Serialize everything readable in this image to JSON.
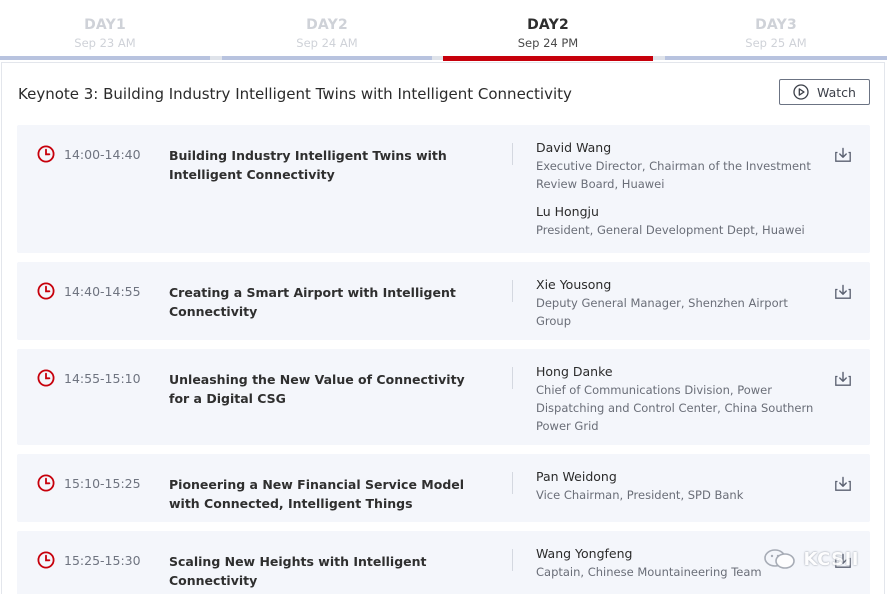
{
  "tabs": [
    {
      "day": "DAY1",
      "date": "Sep 23 AM",
      "active": false
    },
    {
      "day": "DAY2",
      "date": "Sep 24 AM",
      "active": false
    },
    {
      "day": "DAY2",
      "date": "Sep 24 PM",
      "active": true
    },
    {
      "day": "DAY3",
      "date": "Sep 25 AM",
      "active": false
    }
  ],
  "keynote": {
    "title": "Keynote 3: Building Industry Intelligent Twins with Intelligent Connectivity",
    "watch_label": "Watch"
  },
  "sessions": [
    {
      "time": "14:00-14:40",
      "title": "Building Industry Intelligent Twins with Intelligent Connectivity",
      "speakers": [
        {
          "name": "David Wang",
          "role": "Executive Director, Chairman of the Investment Review Board, Huawei"
        },
        {
          "name": "Lu Hongju",
          "role": "President, General Development Dept, Huawei"
        }
      ]
    },
    {
      "time": "14:40-14:55",
      "title": "Creating a Smart Airport with Intelligent Connectivity",
      "speakers": [
        {
          "name": "Xie Yousong",
          "role": "Deputy General Manager, Shenzhen Airport Group"
        }
      ]
    },
    {
      "time": "14:55-15:10",
      "title": "Unleashing the New Value of Connectivity for a Digital CSG",
      "speakers": [
        {
          "name": "Hong Danke",
          "role": "Chief of Communications Division, Power Dispatching and Control Center, China Southern Power Grid"
        }
      ]
    },
    {
      "time": "15:10-15:25",
      "title": "Pioneering a New Financial Service Model with Connected, Intelligent Things",
      "speakers": [
        {
          "name": "Pan Weidong",
          "role": "Vice Chairman, President, SPD Bank"
        }
      ]
    },
    {
      "time": "15:25-15:30",
      "title": "Scaling New Heights with Intelligent Connectivity",
      "speakers": [
        {
          "name": "Wang Yongfeng",
          "role": "Captain, Chinese Mountaineering Team"
        }
      ]
    }
  ],
  "watermark": {
    "text": "KCSII"
  },
  "colors": {
    "accent": "#c7000b",
    "tab_inactive_bar": "#b8c3df",
    "card_bg": "#f4f6fb"
  },
  "icons": {
    "clock": "clock-icon",
    "download": "download-icon",
    "play": "play-circle-icon"
  }
}
